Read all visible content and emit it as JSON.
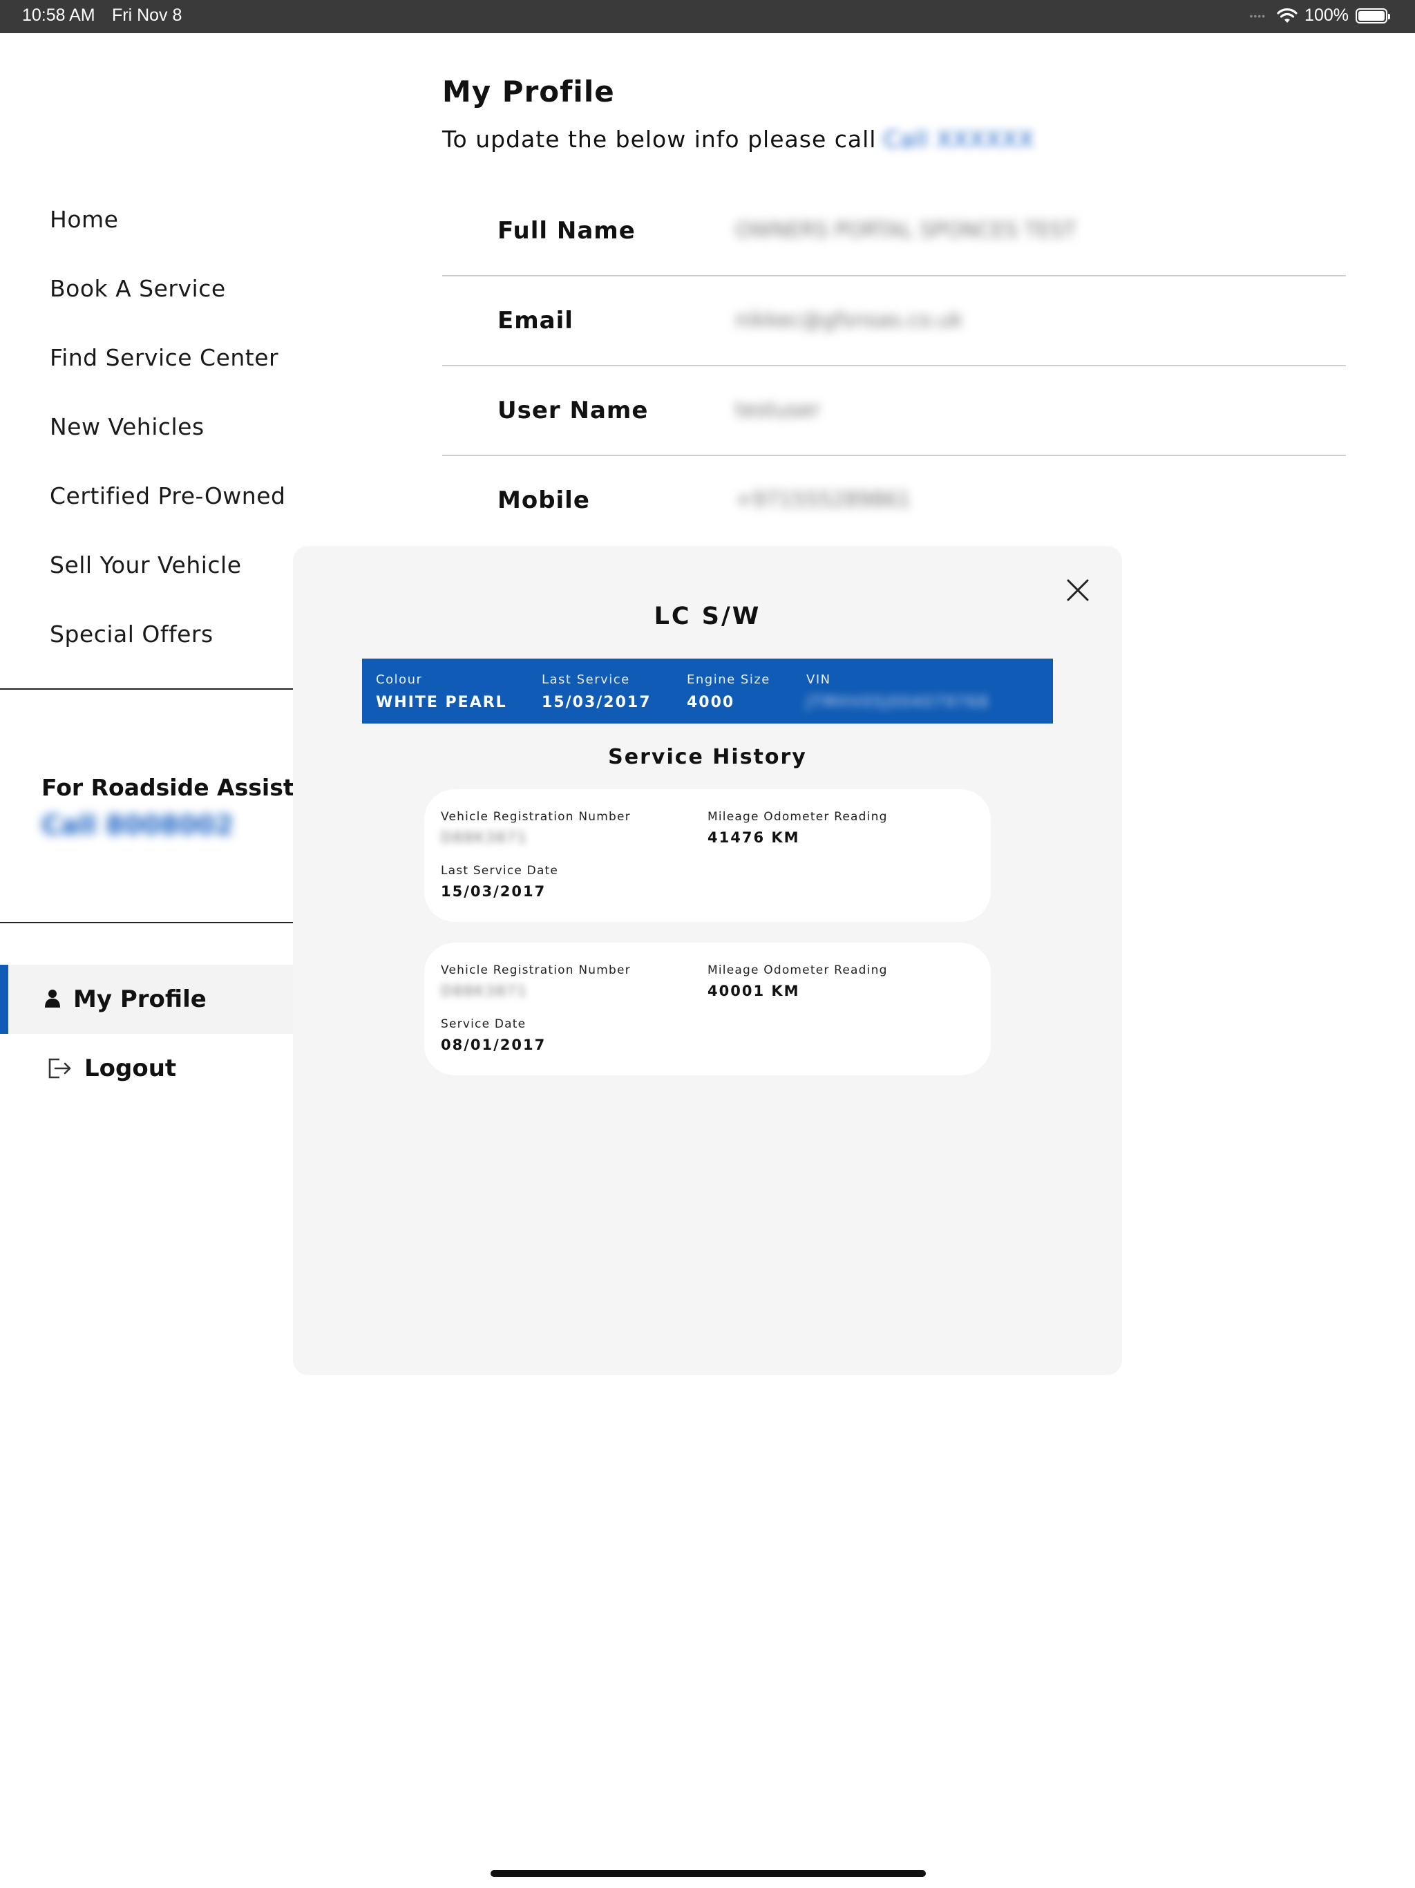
{
  "status_bar": {
    "time": "10:58 AM",
    "date": "Fri Nov 8",
    "signal_dots": "••••",
    "battery_percent": "100%",
    "battery_level": 1.0,
    "icons": [
      "wifi-icon",
      "battery-icon"
    ]
  },
  "sidebar": {
    "items": [
      {
        "label": "Home"
      },
      {
        "label": "Book A Service"
      },
      {
        "label": "Find Service Center"
      },
      {
        "label": "New Vehicles"
      },
      {
        "label": "Certified Pre-Owned"
      },
      {
        "label": "Sell Your Vehicle"
      },
      {
        "label": "Special Offers"
      }
    ],
    "roadside": {
      "title": "For Roadside Assistance",
      "phone": "Call 8008002"
    },
    "account": {
      "profile_label": "My Profile",
      "logout_label": "Logout"
    },
    "accent_color": "#0f5bb5"
  },
  "profile": {
    "title": "My Profile",
    "subtitle": "To update the below info please call",
    "subtitle_phone": "Call XXXXXX",
    "fields": [
      {
        "label": "Full Name",
        "value": "OWNERS PORTAL SPONCES TEST"
      },
      {
        "label": "Email",
        "value": "nikkec@gfsnsas.co.uk"
      },
      {
        "label": "User Name",
        "value": "testuser"
      },
      {
        "label": "Mobile",
        "value": "+971555289861"
      }
    ]
  },
  "modal": {
    "title": "LC S/W",
    "vehicle": {
      "colour_label": "Colour",
      "colour_value": "WHITE PEARL",
      "last_service_label": "Last Service",
      "last_service_value": "15/03/2017",
      "engine_label": "Engine Size",
      "engine_value": "4000",
      "vin_label": "VIN",
      "vin_value": "JTMHV05J004079768"
    },
    "history_title": "Service History",
    "history": [
      {
        "reg_label": "Vehicle Registration Number",
        "reg_value": "D88K3871",
        "mileage_label": "Mileage Odometer Reading",
        "mileage_value": "41476 KM",
        "date_label": "Last Service Date",
        "date_value": "15/03/2017"
      },
      {
        "reg_label": "Vehicle Registration Number",
        "reg_value": "D88K3871",
        "mileage_label": "Mileage Odometer Reading",
        "mileage_value": "40001 KM",
        "date_label": "Service Date",
        "date_value": "08/01/2017"
      }
    ],
    "bar_color": "#0f5bb5"
  }
}
